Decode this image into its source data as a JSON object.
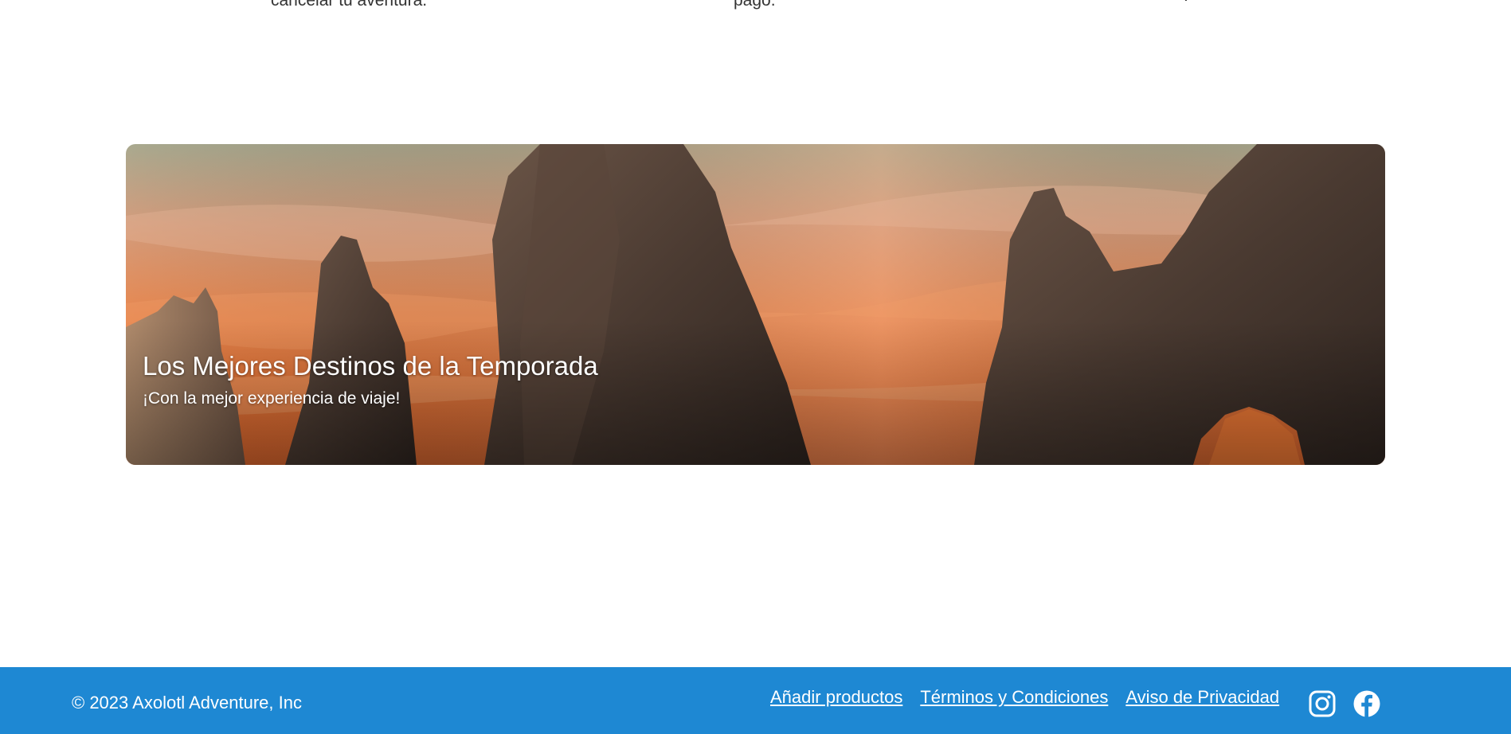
{
  "features": {
    "item1": "cancelar tu aventura.",
    "item2": "pago.",
    "item3": "."
  },
  "banner": {
    "title": "Los Mejores Destinos de la Temporada",
    "subtitle": "¡Con la mejor experiencia de viaje!"
  },
  "footer": {
    "copyright": "© 2023 Axolotl Adventure, Inc",
    "links": [
      {
        "label": "Añadir productos"
      },
      {
        "label": "Términos y Condiciones"
      },
      {
        "label": "Aviso de Privacidad"
      }
    ],
    "social": [
      "instagram-icon",
      "facebook-icon"
    ]
  },
  "colors": {
    "footer_bg": "#1e88d3",
    "text_dark": "#333333",
    "white": "#ffffff"
  }
}
